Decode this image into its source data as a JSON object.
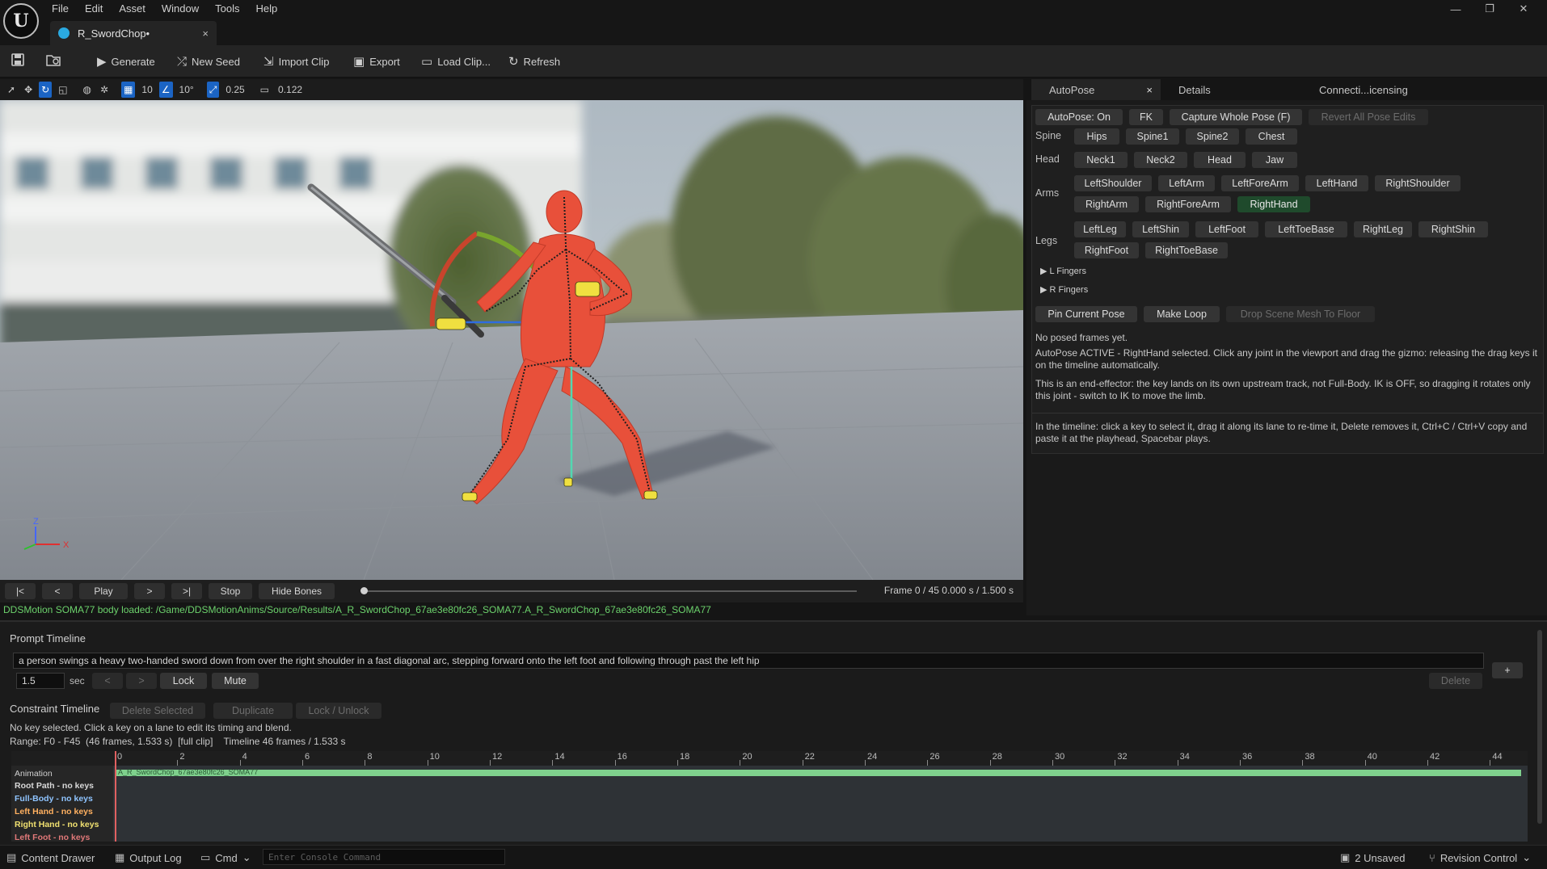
{
  "menu": [
    "File",
    "Edit",
    "Asset",
    "Window",
    "Tools",
    "Help"
  ],
  "logo": "U",
  "window_controls": {
    "minimize": "—",
    "restore": "❐",
    "close": "✕"
  },
  "tab": {
    "title": "R_SwordChop•",
    "close": "×"
  },
  "toolbar": {
    "generate": "Generate",
    "new_seed": "New Seed",
    "import_clip": "Import Clip",
    "export": "Export",
    "load_clip": "Load Clip...",
    "refresh": "Refresh"
  },
  "viewport_toolbar": {
    "grid": "10",
    "angle": "10°",
    "scale": "0.25",
    "camera": "0.122"
  },
  "axis": {
    "z": "Z",
    "x": "X"
  },
  "playback": {
    "first": "|<",
    "prev": "<",
    "play": "Play",
    "next": ">",
    "last": ">|",
    "stop": "Stop",
    "hide_bones": "Hide Bones",
    "progress": 0.0,
    "frame_info": "Frame 0 / 45   0.000 s / 1.500 s"
  },
  "status_message": "DDSMotion SOMA77 body loaded: /Game/DDSMotionAnims/Source/Results/A_R_SwordChop_67ae3e80fc26_SOMA77.A_R_SwordChop_67ae3e80fc26_SOMA77",
  "right_panel": {
    "tabs": [
      "AutoPose",
      "Details",
      "Connecti...icensing"
    ],
    "tab_close": "×",
    "top_buttons": [
      "AutoPose: On",
      "FK",
      "Capture Whole Pose (F)",
      "Revert All Pose Edits"
    ],
    "spine_label": "Spine",
    "spine": [
      "Hips",
      "Spine1",
      "Spine2",
      "Chest"
    ],
    "head_label": "Head",
    "head": [
      "Neck1",
      "Neck2",
      "Head",
      "Jaw"
    ],
    "arms_label": "Arms",
    "arms_row1": [
      "LeftShoulder",
      "LeftArm",
      "LeftForeArm",
      "LeftHand",
      "RightShoulder"
    ],
    "arms_row2": [
      "RightArm",
      "RightForeArm",
      "RightHand"
    ],
    "legs_label": "Legs",
    "legs_row1": [
      "LeftLeg",
      "LeftShin",
      "LeftFoot",
      "LeftToeBase",
      "RightLeg",
      "RightShin"
    ],
    "legs_row2": [
      "RightFoot",
      "RightToeBase"
    ],
    "l_fingers": "L Fingers",
    "r_fingers": "R Fingers",
    "bottom_buttons": [
      "Pin Current Pose",
      "Make Loop",
      "Drop Scene Mesh To Floor"
    ],
    "no_frames": "No posed frames yet.",
    "info1": "AutoPose ACTIVE - RightHand selected. Click any joint in the viewport and drag the gizmo: releasing the drag keys it on the timeline automatically.",
    "info2": "This is an end-effector: the key lands on its own upstream track, not Full-Body. IK is OFF, so dragging it rotates only this joint - switch to IK to move the limb.",
    "info3": "In the timeline: click a key to select it, drag it along its lane to re-time it, Delete removes it, Ctrl+C / Ctrl+V copy and paste it at the playhead, Spacebar plays."
  },
  "prompt_timeline": {
    "title": "Prompt Timeline",
    "prompt": "a person swings a heavy two-handed sword down from over the right shoulder in a fast diagonal arc, stepping forward onto the left foot and following through past the left hip",
    "seconds": "1.5",
    "sec_label": "sec",
    "prev": "<",
    "next": ">",
    "lock": "Lock",
    "mute": "Mute",
    "delete": "Delete",
    "add": "+"
  },
  "constraint_timeline": {
    "title": "Constraint Timeline",
    "delete_selected": "Delete Selected",
    "duplicate": "Duplicate",
    "lock_unlock": "Lock / Unlock",
    "no_key": "No key selected. Click a key on a lane to edit its timing and blend.",
    "range": "Range: F0 - F45  (46 frames, 1.533 s)  [full clip]    Timeline 46 frames / 1.533 s",
    "ticks": [
      "0",
      "2",
      "4",
      "6",
      "8",
      "10",
      "12",
      "14",
      "16",
      "18",
      "20",
      "22",
      "24",
      "26",
      "28",
      "30",
      "32",
      "34",
      "36",
      "38",
      "40",
      "42",
      "44"
    ],
    "animation_label": "Animation",
    "animation_clip": "A_R_SwordChop_67ae3e80fc26_SOMA77",
    "tracks": [
      {
        "label": "Root Path  -  no keys",
        "color": "#d8d8d8"
      },
      {
        "label": "Full-Body  -  no keys",
        "color": "#8fc4ff"
      },
      {
        "label": "Left Hand  -  no keys",
        "color": "#ffb060"
      },
      {
        "label": "Right Hand  -  no keys",
        "color": "#f0e070"
      },
      {
        "label": "Left Foot  -  no keys",
        "color": "#e07878"
      }
    ]
  },
  "statusbar": {
    "content_drawer": "Content Drawer",
    "output_log": "Output Log",
    "cmd": "Cmd",
    "console_placeholder": "Enter Console Command",
    "unsaved": "2 Unsaved",
    "revision": "Revision Control"
  }
}
